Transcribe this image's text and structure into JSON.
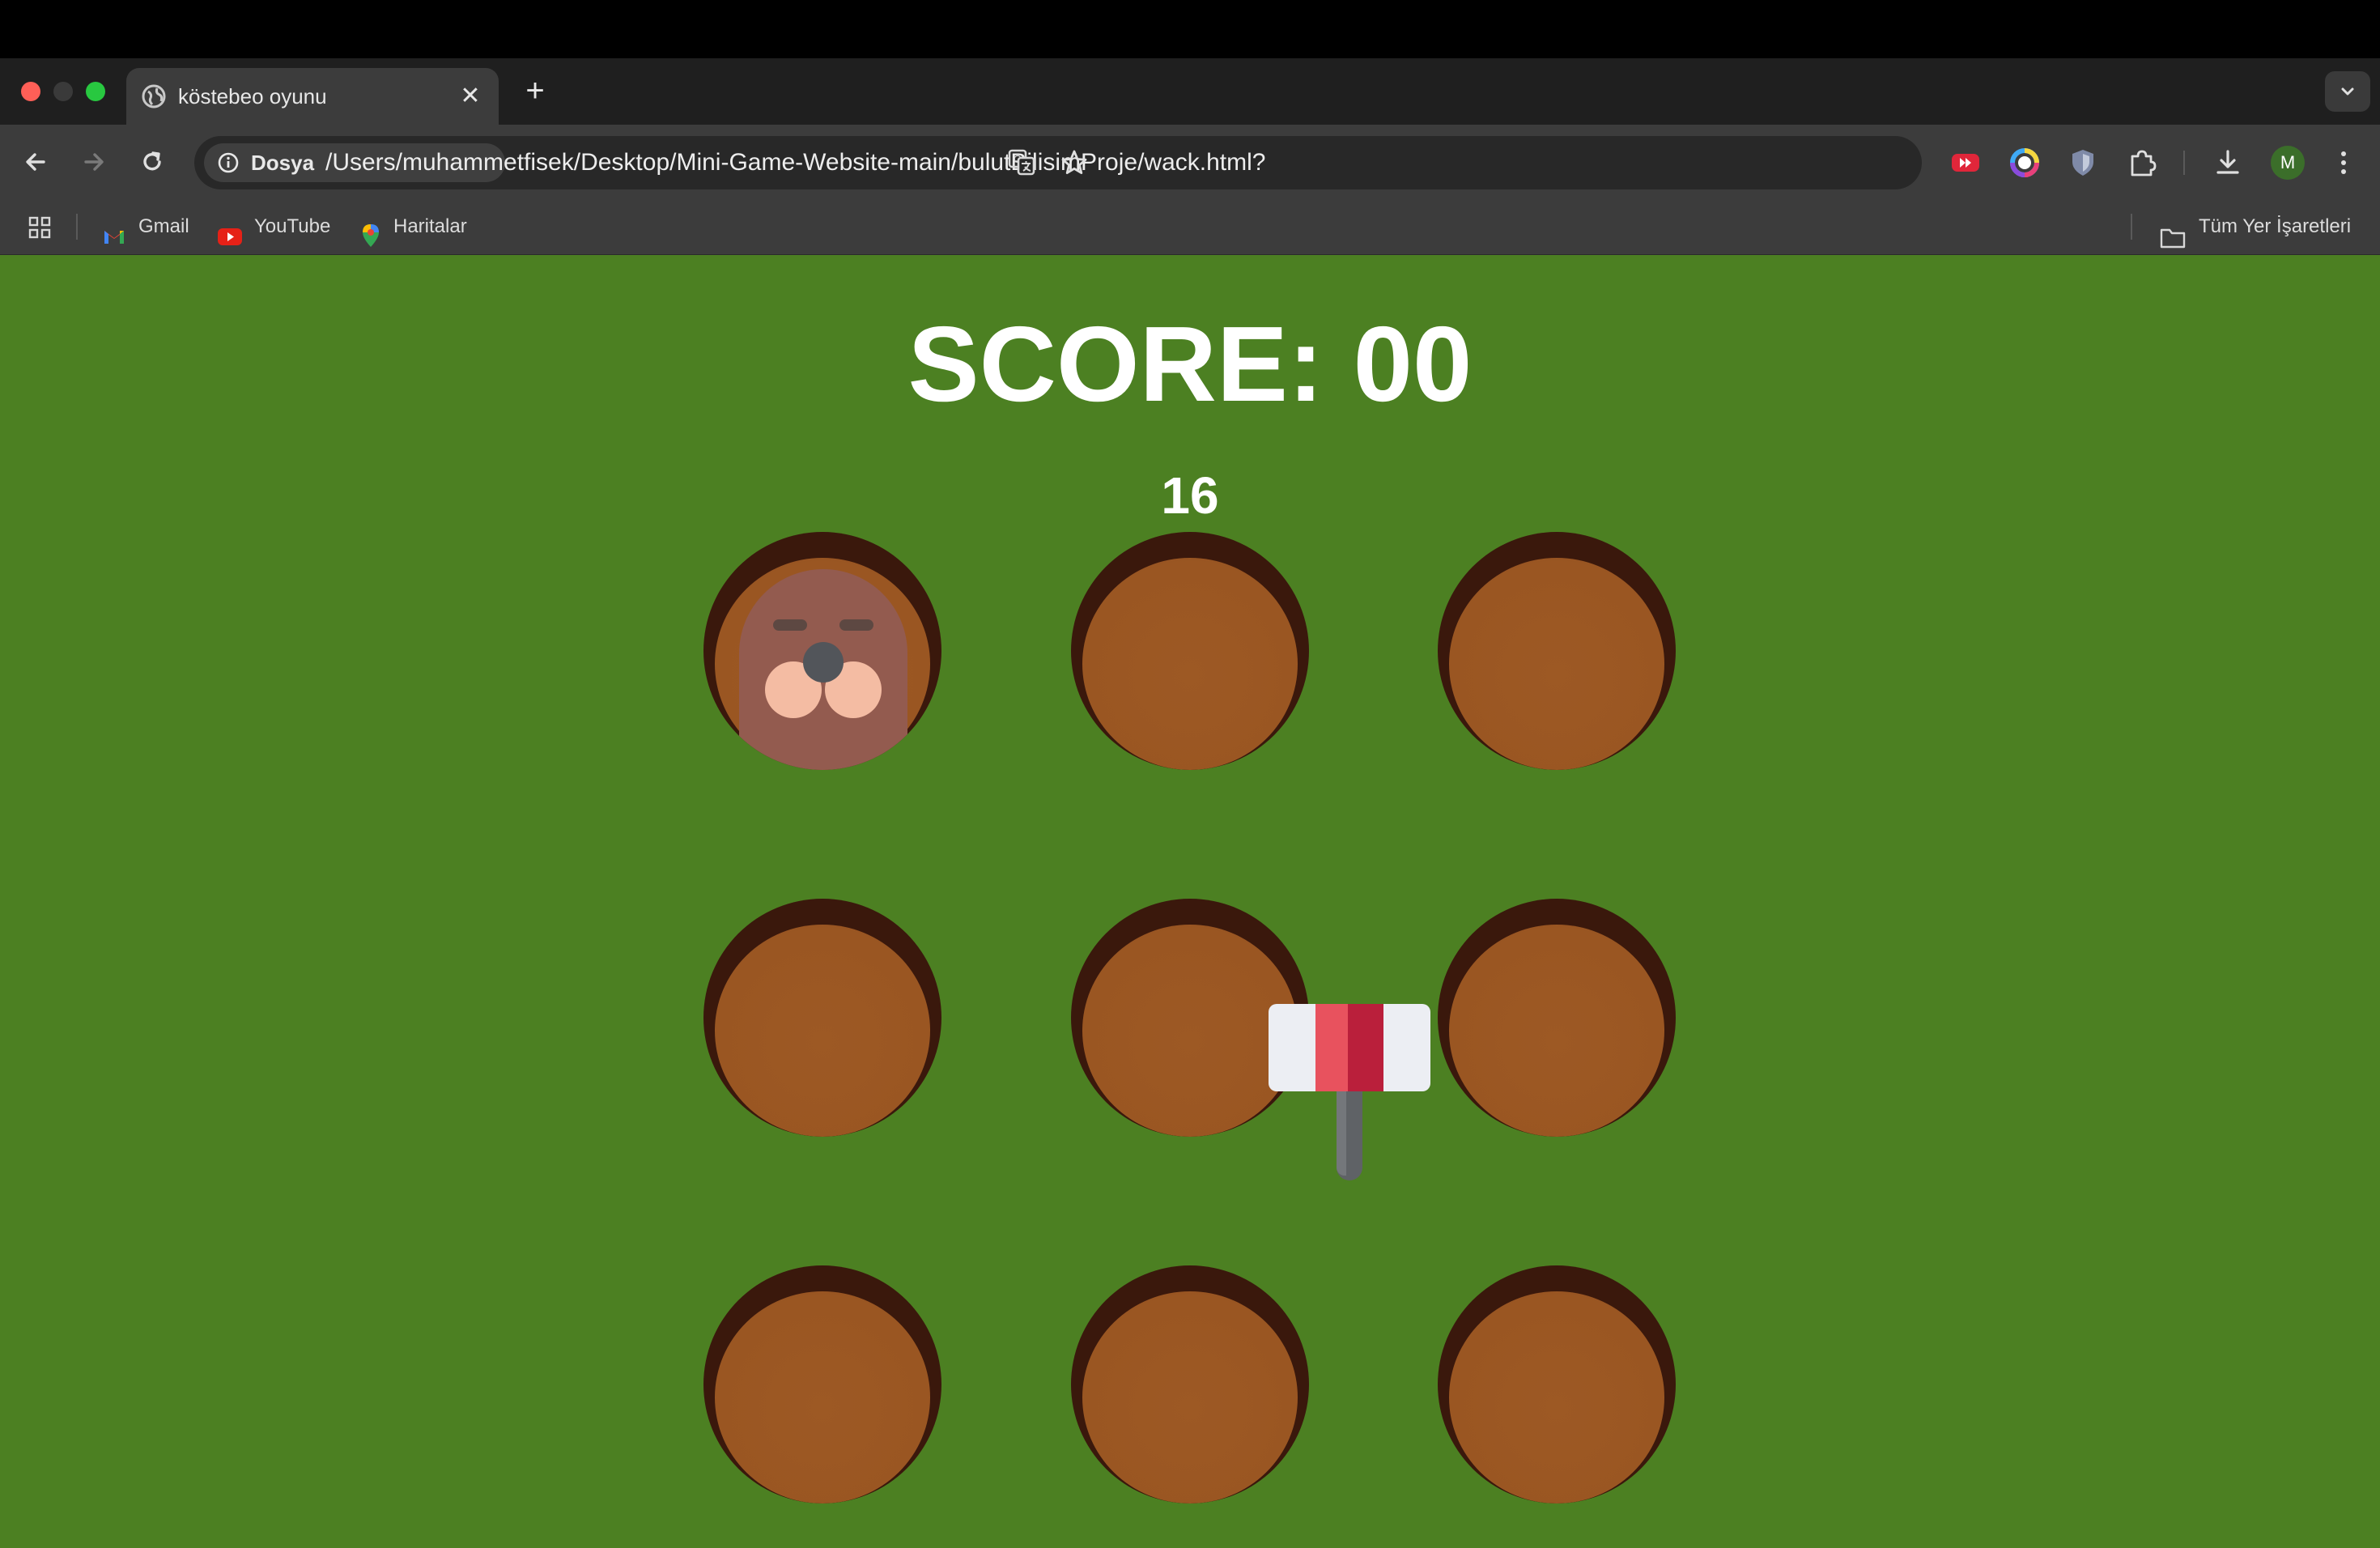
{
  "browser": {
    "tab": {
      "title": "köstebeo oyunu",
      "close_glyph": "✕"
    },
    "new_tab_glyph": "+",
    "omnibox": {
      "chip_label": "Dosya",
      "url": "/Users/muhammetfisek/Desktop/Mini-Game-Website-main/bulutBilisimProje/wack.html?"
    },
    "profile_initial": "M",
    "bookmarks": [
      {
        "label": "Gmail",
        "icon": "gmail-icon"
      },
      {
        "label": "YouTube",
        "icon": "youtube-icon"
      },
      {
        "label": "Haritalar",
        "icon": "maps-icon"
      }
    ],
    "all_bookmarks_label": "Tüm Yer İşaretleri"
  },
  "game": {
    "score_text": "SCORE: 00",
    "timer_text": "16",
    "background_color": "#4c8022",
    "mole_hole_index": 0,
    "holes": 9
  }
}
